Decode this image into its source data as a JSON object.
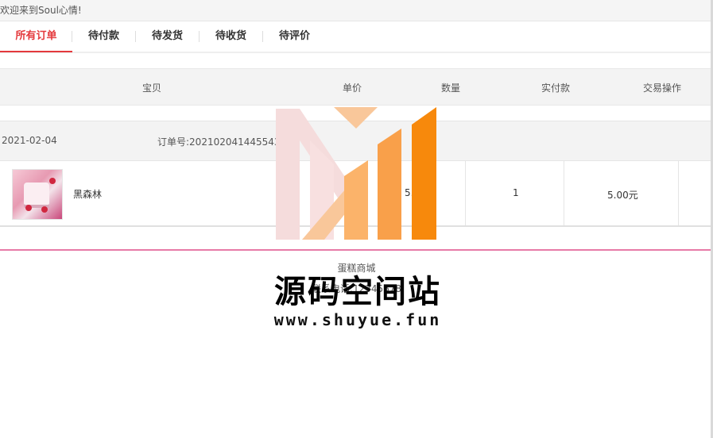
{
  "topbar": {
    "welcome": "欢迎来到Soul心情!"
  },
  "tabs": [
    {
      "label": "所有订单",
      "active": true
    },
    {
      "label": "待付款",
      "active": false
    },
    {
      "label": "待发货",
      "active": false
    },
    {
      "label": "待收货",
      "active": false
    },
    {
      "label": "待评价",
      "active": false
    }
  ],
  "table_header": {
    "product": "宝贝",
    "unit_price": "单价",
    "quantity": "数量",
    "paid": "实付款",
    "action": "交易操作"
  },
  "order": {
    "date": "2021-02-04",
    "order_no_label": "订单号:2021020414455437€",
    "product_name": "黑森林",
    "unit_price": "5.",
    "quantity": "1",
    "paid": "5.00元"
  },
  "footer": {
    "shop_name": "蛋糕商城",
    "contact": "联系电话:12345678"
  },
  "watermark": {
    "title": "源码空间站",
    "url": "www.shuyue.fun"
  },
  "colors": {
    "accent": "#e4393c",
    "footer_line": "#e77aa7",
    "header_bg": "#f3f3f3",
    "logo_orange": "#f7890c",
    "logo_light": "#f9c79a",
    "logo_pink": "#f5dcdc"
  }
}
